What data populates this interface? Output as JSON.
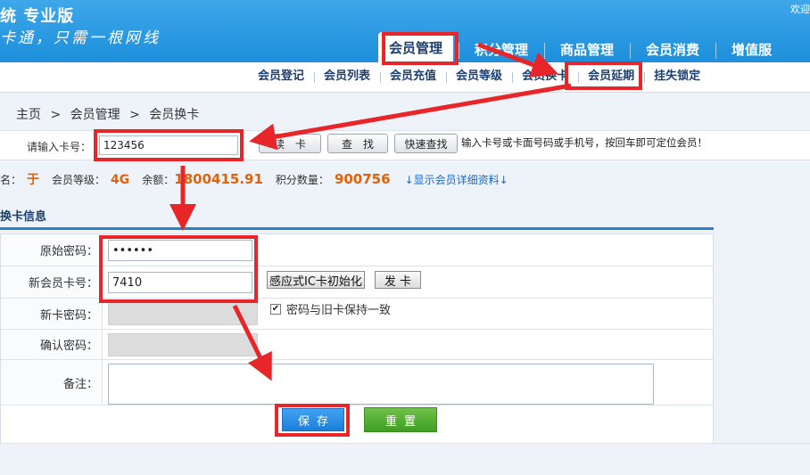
{
  "header": {
    "brand": "统 专业版",
    "slogan": "卡通，只需一根网线",
    "welcome": "欢迎",
    "nav": [
      "会员管理",
      "积分管理",
      "商品管理",
      "会员消费",
      "增值服"
    ]
  },
  "subnav": [
    "会员登记",
    "会员列表",
    "会员充值",
    "会员等级",
    "会员换卡",
    "会员延期",
    "挂失锁定"
  ],
  "breadcrumb": [
    "主页",
    ">",
    "会员管理",
    ">",
    "会员换卡"
  ],
  "search": {
    "label": "请输入卡号：",
    "value": "123456",
    "read_button": "读　卡",
    "find_button": "查　找",
    "quick_find_button": "快速查找",
    "hint": "输入卡号或卡面号码或手机号，按回车即可定位会员！"
  },
  "member": {
    "name_label": "姓名：",
    "name": "于",
    "level_label": "会员等级：",
    "level": "4G",
    "balance_label": "余额：",
    "balance": "1800415.91",
    "points_label": "积分数量：",
    "points": "900756",
    "detail_link": "↓显示会员详细资料↓"
  },
  "section_title": "换卡信息",
  "form": {
    "orig_pwd_label": "原始密码：",
    "orig_pwd_value": "••••••",
    "new_card_label": "新会员卡号：",
    "new_card_value": "7410",
    "ic_init_button": "感应式IC卡初始化",
    "issue_button": "发 卡",
    "new_pwd_label": "新卡密码：",
    "same_pwd_label": "密码与旧卡保持一致",
    "same_pwd_checked": "✔",
    "confirm_pwd_label": "确认密码：",
    "note_label": "备注："
  },
  "actions": {
    "save": "保存",
    "reset": "重置"
  },
  "colors": {
    "header_blue": "#1d8fdc",
    "accent_orange": "#e0620a",
    "annotation_red": "#e8262a",
    "save_blue": "#1c7ed9",
    "reset_green": "#3f9e23"
  }
}
